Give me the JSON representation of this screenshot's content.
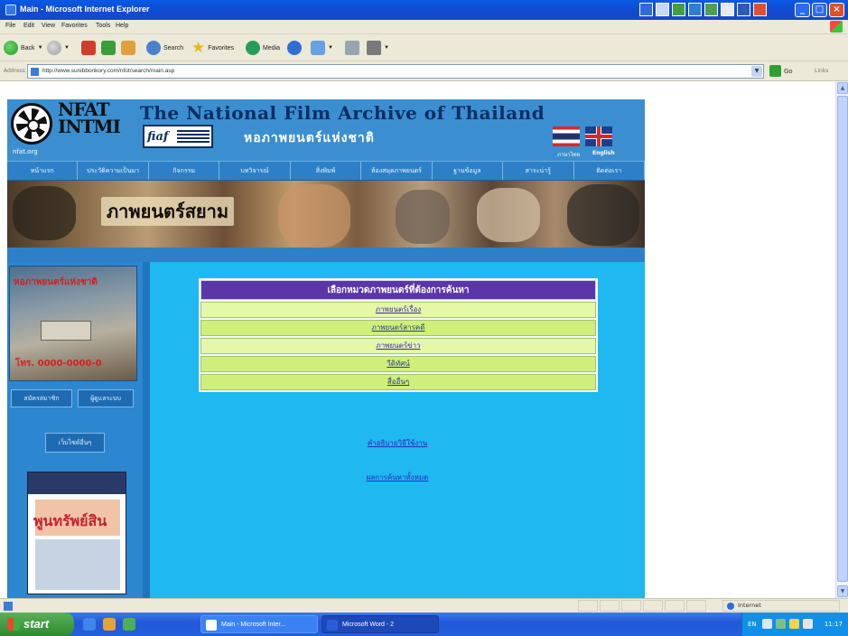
{
  "window": {
    "title": "Main - Microsoft Internet Explorer",
    "controls": {
      "minimize": "_",
      "maximize": "□",
      "close": "×"
    }
  },
  "menubar": {
    "items": [
      "File",
      "Edit",
      "View",
      "Favorites",
      "Tools",
      "Help"
    ]
  },
  "toolbar": {
    "back_label": "Back",
    "search_label": "Search",
    "favorites_label": "Favorites",
    "media_label": "Media"
  },
  "addressbar": {
    "label": "Address",
    "url": "http://www.sunibbonkory.com/nfot/search/main.asp",
    "go_label": "Go",
    "links_label": "Links"
  },
  "page": {
    "logo": {
      "line1": "NFAT",
      "line2": "INTMI",
      "org": "nfat.org"
    },
    "site_title": "The National Film Archive of Thailand",
    "fiaf_label": "fiaf",
    "thai_title": "หอภาพยนตร์แห่งชาติ",
    "lang_thai": "ภาษาไทย",
    "lang_english": "English",
    "nav": [
      "หน้าแรก",
      "ประวัติความเป็นมา",
      "กิจกรรม",
      "บทวิจารณ์",
      "สิ่งพิมพ์",
      "ห้องสมุดภาพยนตร์",
      "ฐานข้อมูล",
      "สาระน่ารู้",
      "ติดต่อเรา"
    ],
    "banner_title": "ภาพยนตร์สยาม",
    "sidebar": {
      "promo_caption": "หอภาพยนตร์แห่งชาติ",
      "promo_phone": "โทร. 0000-0000-0",
      "join_label": "สมัครสมาชิก",
      "admin_label": "ผู้ดูแลระบบ",
      "links_label": "เว็บไซต์อื่นๆ",
      "poster_text": "พูนทรัพย์สิน"
    },
    "categories": {
      "header": "เลือกหมวดภาพยนตร์ที่ต้องการค้นหา",
      "items": [
        "ภาพยนตร์เรื่อง",
        "ภาพยนตร์สารคดี",
        "ภาพยนตร์ข่าว",
        "วีดิทัศน์",
        "สื่ออื่นๆ"
      ]
    },
    "usage_link": "คำอธิบายวิธีใช้งาน",
    "search_all_link": "ผลการค้นหาทั้งหมด"
  },
  "statusbar": {
    "zone": "Internet"
  },
  "taskbar": {
    "start": "start",
    "tasks": [
      "Main - Microsoft Inter...",
      "Microsoft Word - 2"
    ],
    "lang": "EN",
    "clock": "11:17"
  },
  "colors": {
    "header_blue": "#3b8fd0",
    "main_cyan": "#1fb8f0",
    "category_header_purple": "#5b36a8",
    "category_row_lime": "#e5f8a8"
  }
}
